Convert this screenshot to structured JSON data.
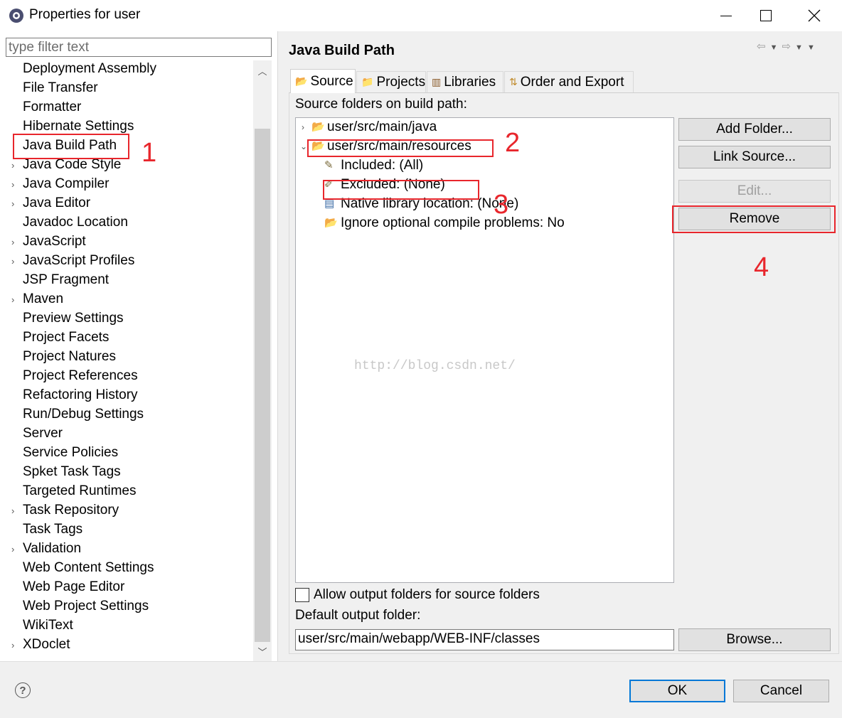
{
  "window": {
    "title": "Properties for user",
    "icon": "eclipse-gear-icon"
  },
  "filter": {
    "placeholder": "type filter text",
    "value": ""
  },
  "tree": [
    {
      "label": "Deployment Assembly",
      "expandable": false
    },
    {
      "label": "File Transfer",
      "expandable": false
    },
    {
      "label": "Formatter",
      "expandable": false
    },
    {
      "label": "Hibernate Settings",
      "expandable": false
    },
    {
      "label": "Java Build Path",
      "expandable": false,
      "selected": true
    },
    {
      "label": "Java Code Style",
      "expandable": true
    },
    {
      "label": "Java Compiler",
      "expandable": true
    },
    {
      "label": "Java Editor",
      "expandable": true
    },
    {
      "label": "Javadoc Location",
      "expandable": false
    },
    {
      "label": "JavaScript",
      "expandable": true
    },
    {
      "label": "JavaScript Profiles",
      "expandable": true
    },
    {
      "label": "JSP Fragment",
      "expandable": false
    },
    {
      "label": "Maven",
      "expandable": true
    },
    {
      "label": "Preview Settings",
      "expandable": false
    },
    {
      "label": "Project Facets",
      "expandable": false
    },
    {
      "label": "Project Natures",
      "expandable": false
    },
    {
      "label": "Project References",
      "expandable": false
    },
    {
      "label": "Refactoring History",
      "expandable": false
    },
    {
      "label": "Run/Debug Settings",
      "expandable": false
    },
    {
      "label": "Server",
      "expandable": false
    },
    {
      "label": "Service Policies",
      "expandable": false
    },
    {
      "label": "Spket Task Tags",
      "expandable": false
    },
    {
      "label": "Targeted Runtimes",
      "expandable": false
    },
    {
      "label": "Task Repository",
      "expandable": true
    },
    {
      "label": "Task Tags",
      "expandable": false
    },
    {
      "label": "Validation",
      "expandable": true
    },
    {
      "label": "Web Content Settings",
      "expandable": false
    },
    {
      "label": "Web Page Editor",
      "expandable": false
    },
    {
      "label": "Web Project Settings",
      "expandable": false
    },
    {
      "label": "WikiText",
      "expandable": false
    },
    {
      "label": "XDoclet",
      "expandable": true
    }
  ],
  "page": {
    "title": "Java Build Path",
    "tabs": [
      {
        "label": "Source",
        "icon": "source-folder-icon",
        "active": true
      },
      {
        "label": "Projects",
        "icon": "projects-icon"
      },
      {
        "label": "Libraries",
        "icon": "libraries-icon"
      },
      {
        "label": "Order and Export",
        "icon": "order-export-icon"
      }
    ],
    "section_label": "Source folders on build path:",
    "source_folders": [
      {
        "label": "user/src/main/java",
        "expanded": false
      },
      {
        "label": "user/src/main/resources",
        "expanded": true,
        "children": [
          "Included: (All)",
          "Excluded: (None)",
          "Native library location: (None)",
          "Ignore optional compile problems: No"
        ]
      }
    ],
    "buttons": {
      "add_folder": "Add Folder...",
      "link_source": "Link Source...",
      "edit": "Edit...",
      "remove": "Remove",
      "browse": "Browse..."
    },
    "allow_output_label": "Allow output folders for source folders",
    "allow_output_checked": false,
    "default_output_label": "Default output folder:",
    "default_output_value": "user/src/main/webapp/WEB-INF/classes"
  },
  "footer": {
    "ok": "OK",
    "cancel": "Cancel"
  },
  "annotations": [
    "1",
    "2",
    "3",
    "4"
  ],
  "watermark": "http://blog.csdn.net/",
  "colors": {
    "annotation_red": "#e8262c",
    "ok_border": "#0078d7",
    "panel_bg": "#f0f0f0"
  }
}
